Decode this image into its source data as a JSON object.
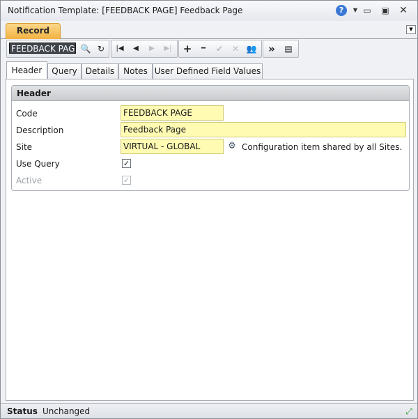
{
  "window": {
    "title": "Notification Template: [FEEDBACK PAGE] Feedback Page",
    "icons": [
      "help-icon",
      "dropdown-arrow-icon",
      "minimize-icon",
      "restore-icon",
      "close-icon"
    ],
    "help_glyph": "?",
    "drop_glyph": "▼",
    "min_glyph": "▭",
    "max_glyph": "▣",
    "close_glyph": "✕"
  },
  "ribbon": {
    "tab_label": "Record",
    "menu_glyph": "▼"
  },
  "toolbar": {
    "search_value": "FEEDBACK PAGE",
    "buttons": {
      "search": "🔍",
      "refresh": "↻",
      "first": "|◀",
      "prev": "◀",
      "next": "▶",
      "last": "▶|",
      "add": "+",
      "delete": "━",
      "save": "✔",
      "cancel": "✕",
      "users": "👥",
      "more": "»",
      "list": "▤"
    }
  },
  "tabs": [
    {
      "label": "Header",
      "active": true
    },
    {
      "label": "Query",
      "active": false
    },
    {
      "label": "Details",
      "active": false
    },
    {
      "label": "Notes",
      "active": false
    },
    {
      "label": "User Defined Field Values",
      "active": false
    }
  ],
  "header_section": {
    "title": "Header",
    "code_label": "Code",
    "code_value": "FEEDBACK PAGE",
    "description_label": "Description",
    "description_value": "Feedback Page",
    "site_label": "Site",
    "site_value": "VIRTUAL - GLOBAL",
    "site_note": "Configuration item shared by all Sites.",
    "use_query_label": "Use Query",
    "use_query_checked": true,
    "active_label": "Active",
    "active_checked": true,
    "check_glyph": "✓",
    "config_glyph": "⚙"
  },
  "status": {
    "label": "Status",
    "value": "Unchanged",
    "resize_glyph": "⤢"
  },
  "colors": {
    "record_tab": "#f3b242",
    "field_background": "#fffbb3",
    "help_icon": "#3a78d6"
  }
}
